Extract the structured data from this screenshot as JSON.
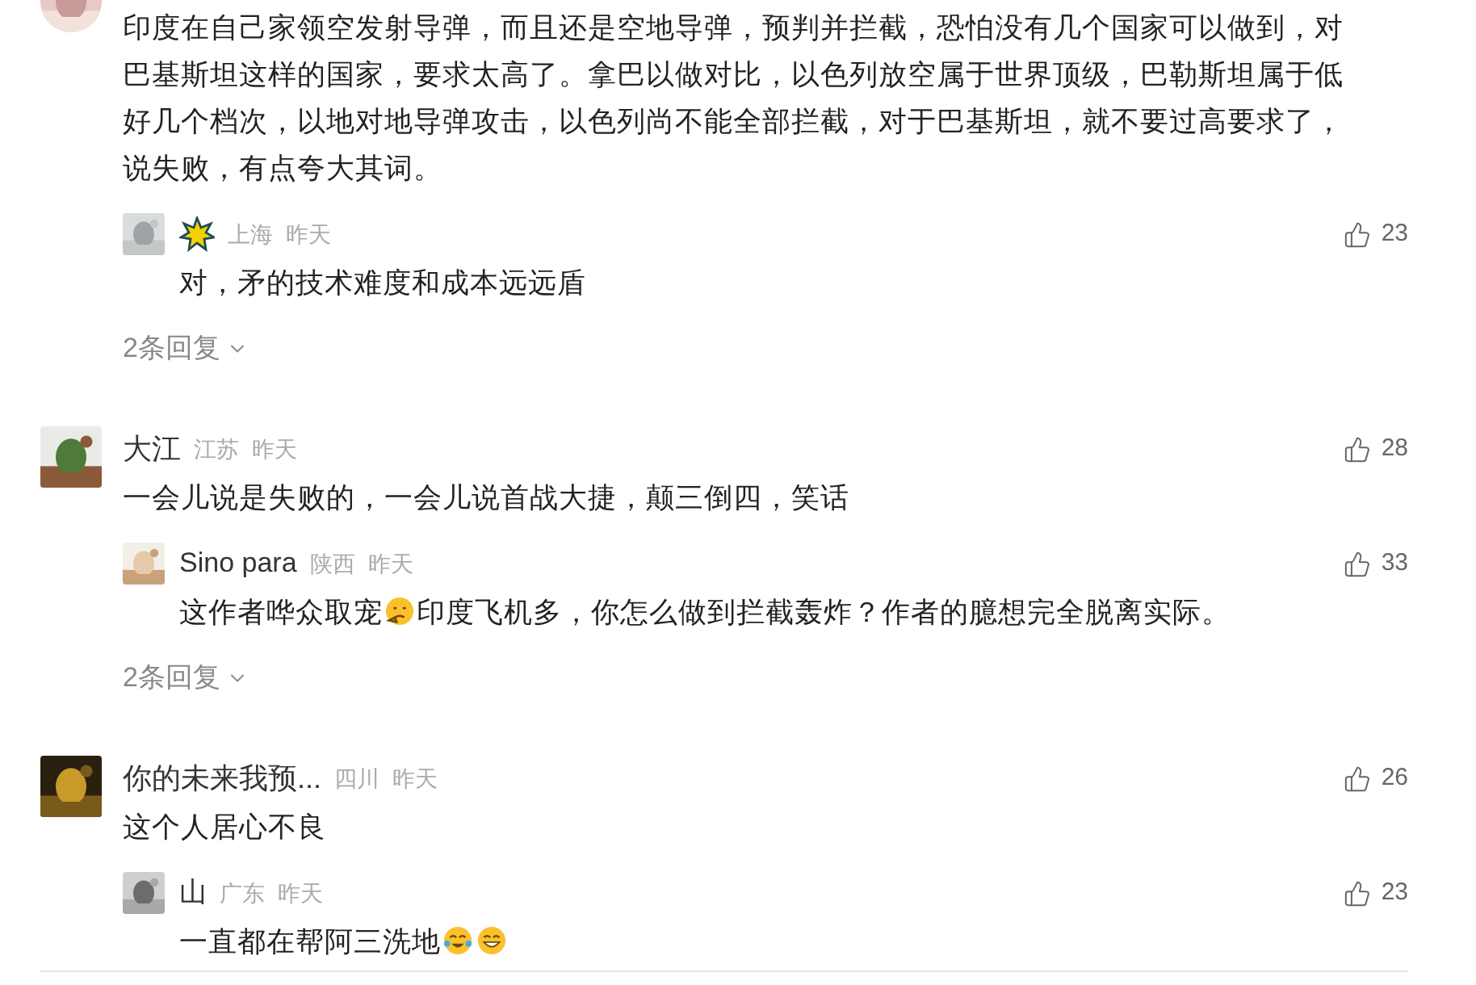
{
  "comments": [
    {
      "text": [
        {
          "kind": "text",
          "text": "印度在自己家领空发射导弹，而且还是空地导弹，预判并拦截，恐怕没有几个国家可以做到，对巴基斯坦这样的国家，要求太高了。拿巴以做对比，以色列放空属于世界顶级，巴勒斯坦属于低好几个档次，以地对地导弹攻击，以色列尚不能全部拦截，对于巴基斯坦，就不要过高要求了，说失败，有点夸大其词。"
        }
      ],
      "replies": [
        {
          "author": {
            "kind": "sticker"
          },
          "location": "上海",
          "time": "昨天",
          "likes": "23",
          "text": [
            {
              "kind": "text",
              "text": "对，矛的技术难度和成本远远盾"
            }
          ]
        }
      ],
      "more_replies": "2条回复"
    },
    {
      "author": {
        "kind": "text",
        "name": "大江"
      },
      "location": "江苏",
      "time": "昨天",
      "likes": "28",
      "text": [
        {
          "kind": "text",
          "text": "一会儿说是失败的，一会儿说首战大捷，颠三倒四，笑话"
        }
      ],
      "replies": [
        {
          "author": {
            "kind": "text",
            "name": "Sino para"
          },
          "location": "陕西",
          "time": "昨天",
          "likes": "33",
          "text": [
            {
              "kind": "text",
              "text": "这作者哗众取宠"
            },
            {
              "kind": "thinking"
            },
            {
              "kind": "text",
              "text": "印度飞机多，你怎么做到拦截轰炸？作者的臆想完全脱离实际。"
            }
          ]
        }
      ],
      "more_replies": "2条回复"
    },
    {
      "author": {
        "kind": "text",
        "name": "你的未来我预..."
      },
      "location": "四川",
      "time": "昨天",
      "likes": "26",
      "text": [
        {
          "kind": "text",
          "text": "这个人居心不良"
        }
      ],
      "replies": [
        {
          "author": {
            "kind": "text",
            "name": "山"
          },
          "location": "广东",
          "time": "昨天",
          "likes": "23",
          "text": [
            {
              "kind": "text",
              "text": "一直都在帮阿三洗地"
            },
            {
              "kind": "crying-laugh"
            },
            {
              "kind": "grin"
            }
          ]
        }
      ]
    }
  ]
}
